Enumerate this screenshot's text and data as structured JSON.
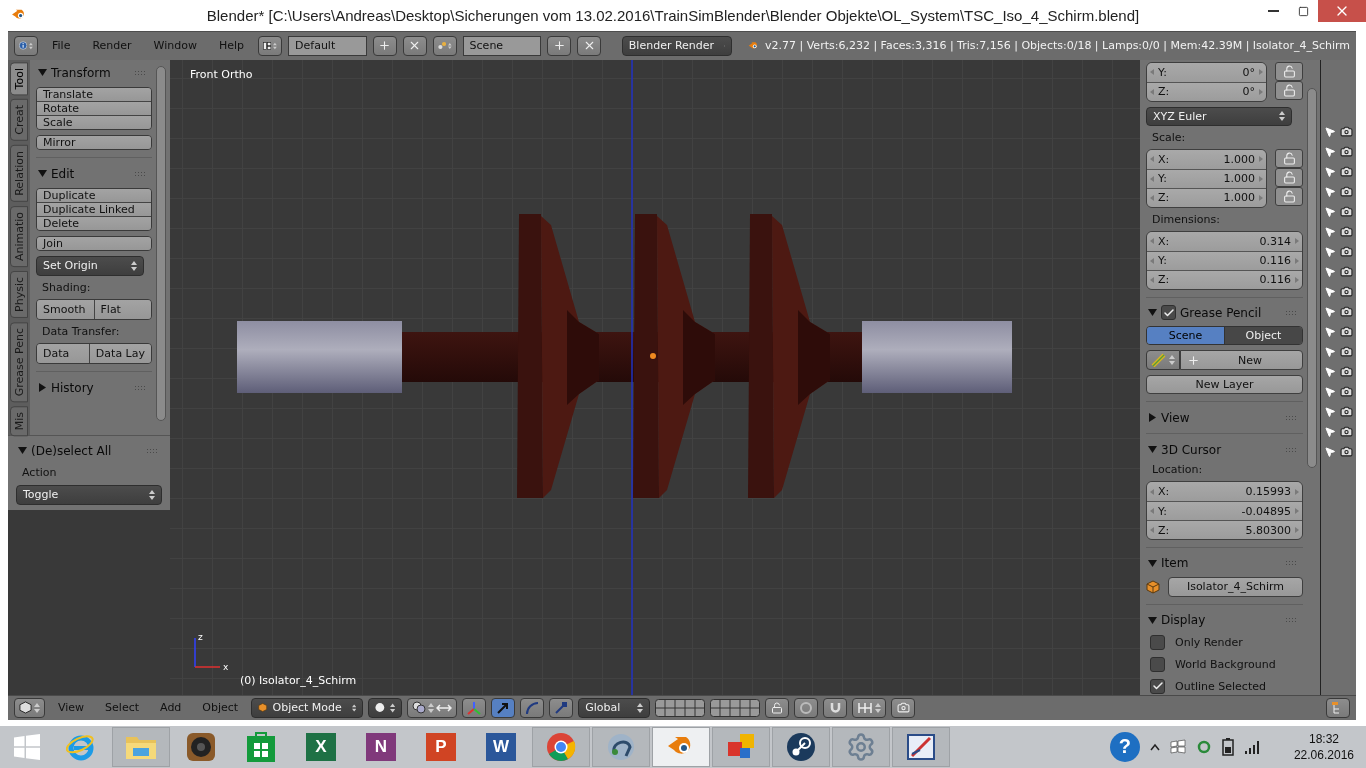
{
  "window": {
    "title": "Blender* [C:\\Users\\Andreas\\Desktop\\Sicherungen vom 13.02.2016\\TrainSimBlender\\Blender Objekte\\OL_System\\TSC_Iso_4_Schirm.blend]"
  },
  "info_header": {
    "menus": [
      "File",
      "Render",
      "Window",
      "Help"
    ],
    "layout": "Default",
    "scene": "Scene",
    "engine": "Blender Render",
    "stats": "v2.77 | Verts:6,232 | Faces:3,316 | Tris:7,156 | Objects:0/18 | Lamps:0/0 | Mem:42.39M | Isolator_4_Schirm"
  },
  "tool_shelf": {
    "tabs": [
      {
        "label": "Tool",
        "selected": true
      },
      {
        "label": "Creat",
        "selected": false
      },
      {
        "label": "Relation",
        "selected": false
      },
      {
        "label": "Animatio",
        "selected": false
      },
      {
        "label": "Physic",
        "selected": false
      },
      {
        "label": "Grease Penc",
        "selected": false
      },
      {
        "label": "Mis",
        "selected": false
      }
    ],
    "panels": [
      {
        "title": "Transform",
        "expanded": true,
        "items": [
          {
            "kind": "group",
            "buttons": [
              "Translate",
              "Rotate",
              "Scale"
            ]
          },
          {
            "kind": "group",
            "buttons": [
              "Mirror"
            ]
          }
        ]
      },
      {
        "title": "Edit",
        "expanded": true,
        "items": [
          {
            "kind": "group",
            "buttons": [
              "Duplicate",
              "Duplicate Linked",
              "Delete"
            ]
          },
          {
            "kind": "group",
            "buttons": [
              "Join"
            ]
          },
          {
            "kind": "dropdown",
            "value": "Set Origin"
          },
          {
            "kind": "label",
            "text": "Shading:"
          },
          {
            "kind": "row",
            "buttons": [
              "Smooth",
              "Flat"
            ]
          },
          {
            "kind": "label",
            "text": "Data Transfer:"
          },
          {
            "kind": "row",
            "buttons": [
              "Data",
              "Data Lay"
            ]
          }
        ]
      },
      {
        "title": "History",
        "expanded": false
      }
    ]
  },
  "operator_panel": {
    "title": "(De)select All",
    "expanded": true,
    "label": "Action",
    "value": "Toggle"
  },
  "viewport": {
    "view_name": "Front Ortho",
    "object_label": "(0) Isolator_4_Schirm",
    "axis_labels": [
      "z",
      "x"
    ]
  },
  "properties": {
    "rotation": [
      {
        "axis": "Y:",
        "value": "0°"
      },
      {
        "axis": "Z:",
        "value": "0°"
      }
    ],
    "rotation_mode": "XYZ Euler",
    "scale": {
      "label": "Scale:",
      "fields": [
        {
          "axis": "X:",
          "value": "1.000"
        },
        {
          "axis": "Y:",
          "value": "1.000"
        },
        {
          "axis": "Z:",
          "value": "1.000"
        }
      ]
    },
    "dimensions": {
      "label": "Dimensions:",
      "fields": [
        {
          "axis": "X:",
          "value": "0.314"
        },
        {
          "axis": "Y:",
          "value": "0.116"
        },
        {
          "axis": "Z:",
          "value": "0.116"
        }
      ]
    },
    "grease_pencil": {
      "title": "Grease Pencil",
      "enabled": true,
      "expanded": true,
      "tabs": [
        {
          "label": "Scene",
          "selected": true
        },
        {
          "label": "Object",
          "selected": false
        }
      ],
      "new": "New",
      "new_layer": "New Layer"
    },
    "view": {
      "title": "View",
      "expanded": false
    },
    "cursor": {
      "title": "3D Cursor",
      "expanded": true,
      "label": "Location:",
      "fields": [
        {
          "axis": "X:",
          "value": "0.15993"
        },
        {
          "axis": "Y:",
          "value": "-0.04895"
        },
        {
          "axis": "Z:",
          "value": "5.80300"
        }
      ]
    },
    "item": {
      "title": "Item",
      "expanded": true,
      "name": "Isolator_4_Schirm"
    },
    "display": {
      "title": "Display",
      "expanded": true,
      "options": [
        {
          "label": "Only Render",
          "checked": false
        },
        {
          "label": "World Background",
          "checked": false
        },
        {
          "label": "Outline Selected",
          "checked": true
        }
      ]
    }
  },
  "view3d_header": {
    "menus": [
      "View",
      "Select",
      "Add",
      "Object"
    ],
    "mode": "Object Mode",
    "manipulators": [
      {
        "kind": "axes",
        "selected": false
      },
      {
        "kind": "translate",
        "selected": true
      },
      {
        "kind": "rotate",
        "selected": false
      },
      {
        "kind": "scale",
        "selected": false
      }
    ],
    "orientation": "Global"
  },
  "taskbar": {
    "apps": [
      {
        "kind": "ie",
        "running": false,
        "selected": false
      },
      {
        "kind": "folder",
        "running": true,
        "selected": false
      },
      {
        "kind": "speaker",
        "running": false,
        "selected": false
      },
      {
        "kind": "store",
        "running": false,
        "selected": false
      },
      {
        "kind": "office",
        "letter": "X",
        "color": "#1e7145",
        "running": false,
        "selected": false
      },
      {
        "kind": "office",
        "letter": "N",
        "color": "#80397b",
        "running": false,
        "selected": false
      },
      {
        "kind": "office",
        "letter": "P",
        "color": "#d04423",
        "running": false,
        "selected": false
      },
      {
        "kind": "office",
        "letter": "W",
        "color": "#2b579a",
        "running": false,
        "selected": false
      },
      {
        "kind": "chrome",
        "running": true,
        "selected": false
      },
      {
        "kind": "teamspeak",
        "running": true,
        "selected": false
      },
      {
        "kind": "blender",
        "running": true,
        "selected": true
      },
      {
        "kind": "tiles",
        "running": true,
        "selected": false
      },
      {
        "kind": "steam",
        "running": true,
        "selected": false
      },
      {
        "kind": "gear",
        "running": true,
        "selected": false
      },
      {
        "kind": "pen",
        "running": true,
        "selected": false
      }
    ],
    "help": "?",
    "time": "18:32",
    "date": "22.06.2016"
  }
}
